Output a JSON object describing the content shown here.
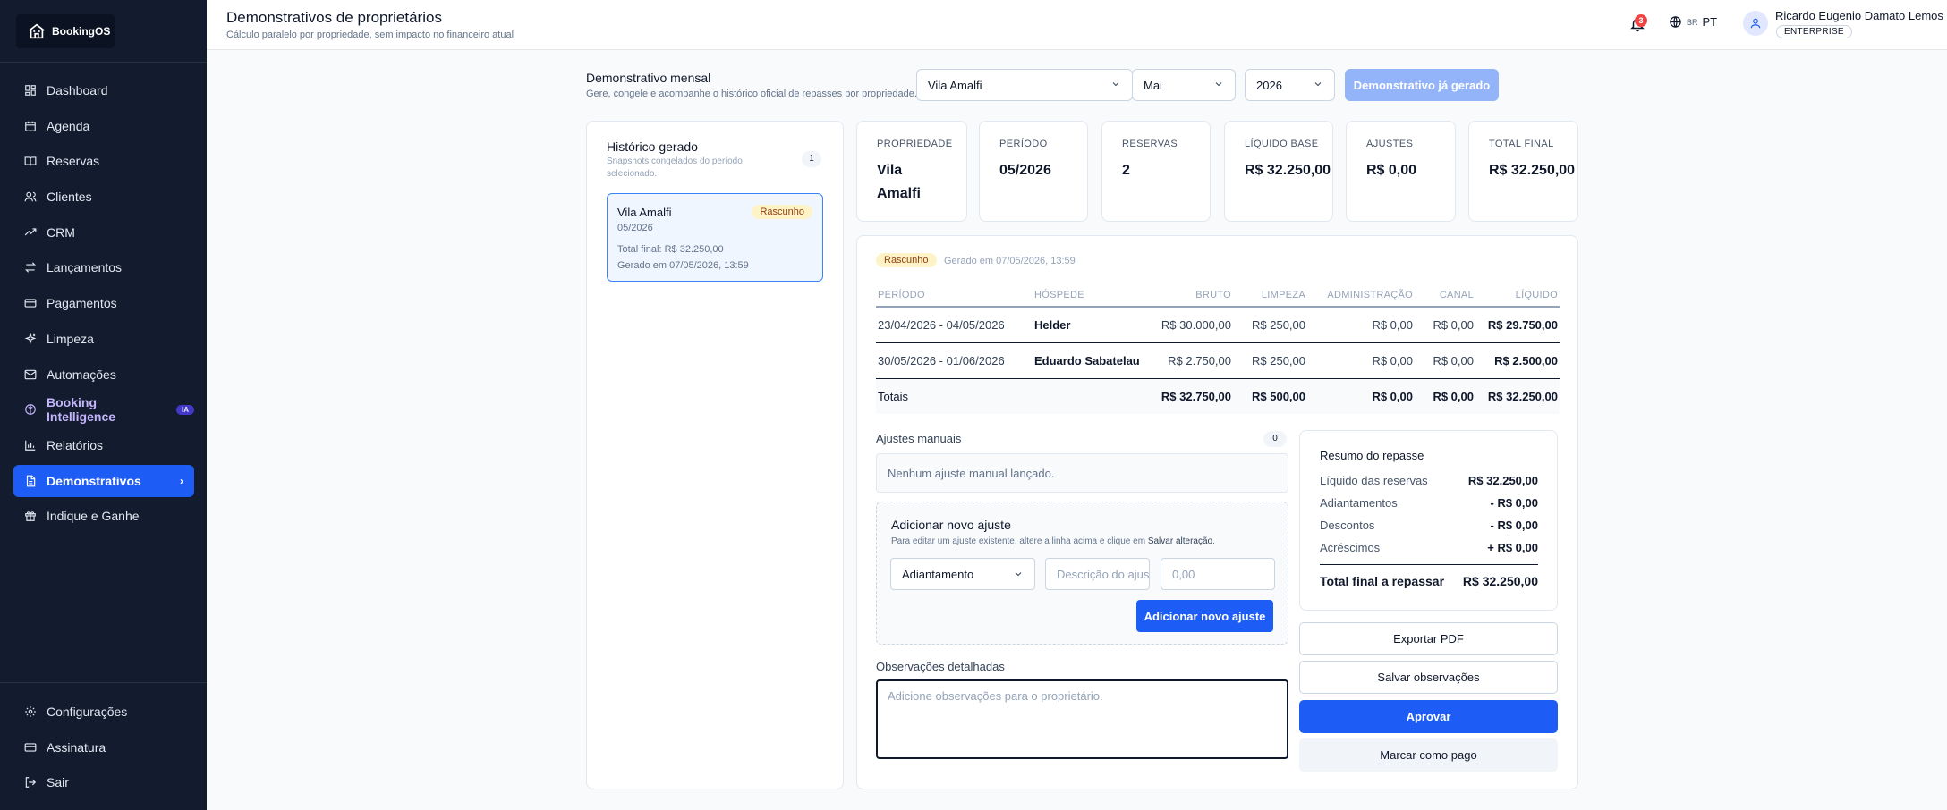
{
  "app": {
    "logo_text": "BookingOS"
  },
  "sidebar": {
    "items": [
      {
        "label": "Dashboard",
        "icon": "dashboard-icon"
      },
      {
        "label": "Agenda",
        "icon": "calendar-icon"
      },
      {
        "label": "Reservas",
        "icon": "book-icon"
      },
      {
        "label": "Clientes",
        "icon": "users-icon"
      },
      {
        "label": "CRM",
        "icon": "trend-icon"
      },
      {
        "label": "Lançamentos",
        "icon": "transfer-icon"
      },
      {
        "label": "Pagamentos",
        "icon": "card-icon"
      },
      {
        "label": "Limpeza",
        "icon": "sparkle-icon"
      },
      {
        "label": "Automações",
        "icon": "mail-icon"
      },
      {
        "label": "Booking Intelligence",
        "icon": "brain-icon",
        "badge": "IA"
      },
      {
        "label": "Relatórios",
        "icon": "bar-chart-icon"
      },
      {
        "label": "Demonstrativos",
        "icon": "document-icon",
        "active": true
      },
      {
        "label": "Indique e Ganhe",
        "icon": "gift-icon"
      }
    ],
    "bottom": [
      {
        "label": "Configurações",
        "icon": "gear-icon"
      },
      {
        "label": "Assinatura",
        "icon": "card-icon"
      },
      {
        "label": "Sair",
        "icon": "logout-icon"
      }
    ]
  },
  "header": {
    "title": "Demonstrativos de proprietários",
    "subtitle": "Cálculo paralelo por propriedade, sem impacto no financeiro atual",
    "notifications": "3",
    "lang_flag": "BR",
    "lang": "PT",
    "user_name": "Ricardo Eugenio Damato Lemos",
    "plan": "ENTERPRISE"
  },
  "toolbar": {
    "title": "Demonstrativo mensal",
    "subtitle": "Gere, congele e acompanhe o histórico oficial de repasses por propriedade.",
    "property": "Vila Amalfi",
    "month": "Mai",
    "year": "2026",
    "generate_label": "Demonstrativo já gerado"
  },
  "history": {
    "title": "Histórico gerado",
    "subtitle": "Snapshots congelados do período selecionado.",
    "count": "1",
    "snapshot": {
      "name": "Vila Amalfi",
      "status": "Rascunho",
      "period": "05/2026",
      "total": "Total final: R$ 32.250,00",
      "generated": "Gerado em 07/05/2026, 13:59"
    }
  },
  "stats": [
    {
      "label": "PROPRIEDADE",
      "value": "Vila Amalfi"
    },
    {
      "label": "PERÍODO",
      "value": "05/2026"
    },
    {
      "label": "RESERVAS",
      "value": "2"
    },
    {
      "label": "LÍQUIDO BASE",
      "value": "R$ 32.250,00"
    },
    {
      "label": "AJUSTES",
      "value": "R$ 0,00"
    },
    {
      "label": "TOTAL FINAL",
      "value": "R$ 32.250,00"
    }
  ],
  "statement": {
    "status": "Rascunho",
    "generated": "Gerado em 07/05/2026, 13:59",
    "columns": [
      "PERÍODO",
      "HÓSPEDE",
      "BRUTO",
      "LIMPEZA",
      "ADMINISTRAÇÃO",
      "CANAL",
      "LÍQUIDO"
    ],
    "rows": [
      [
        "23/04/2026 - 04/05/2026",
        "Helder",
        "R$ 30.000,00",
        "R$ 250,00",
        "R$ 0,00",
        "R$ 0,00",
        "R$ 29.750,00"
      ],
      [
        "30/05/2026 - 01/06/2026",
        "Eduardo Sabatelau",
        "R$ 2.750,00",
        "R$ 250,00",
        "R$ 0,00",
        "R$ 0,00",
        "R$ 2.500,00"
      ]
    ],
    "totals": [
      "Totais",
      "",
      "R$ 32.750,00",
      "R$ 500,00",
      "R$ 0,00",
      "R$ 0,00",
      "R$ 32.250,00"
    ]
  },
  "adjustments": {
    "title": "Ajustes manuais",
    "count": "0",
    "empty": "Nenhum ajuste manual lançado.",
    "new_title": "Adicionar novo ajuste",
    "new_sub_prefix": "Para editar um ajuste existente, altere a linha acima e clique em ",
    "new_sub_link": "Salvar alteração",
    "new_sub_suffix": ".",
    "type": "Adiantamento",
    "desc_placeholder": "Descrição do ajuste",
    "value_placeholder": "0,00",
    "add_label": "Adicionar novo ajuste"
  },
  "observations": {
    "title": "Observações detalhadas",
    "placeholder": "Adicione observações para o proprietário."
  },
  "summary": {
    "title": "Resumo do repasse",
    "rows": [
      {
        "label": "Líquido das reservas",
        "value": "R$ 32.250,00"
      },
      {
        "label": "Adiantamentos",
        "value": "- R$ 0,00"
      },
      {
        "label": "Descontos",
        "value": "- R$ 0,00"
      },
      {
        "label": "Acréscimos",
        "value": "+ R$ 0,00"
      }
    ],
    "final_label": "Total final a repassar",
    "final_value": "R$ 32.250,00"
  },
  "actions": {
    "export_pdf": "Exportar PDF",
    "save_notes": "Salvar observações",
    "approve": "Aprovar",
    "mark_paid": "Marcar como pago"
  },
  "colors": {
    "accent": "#1d5cf5",
    "sidebar": "#131b2e",
    "draft_badge": "#fef3c7"
  }
}
